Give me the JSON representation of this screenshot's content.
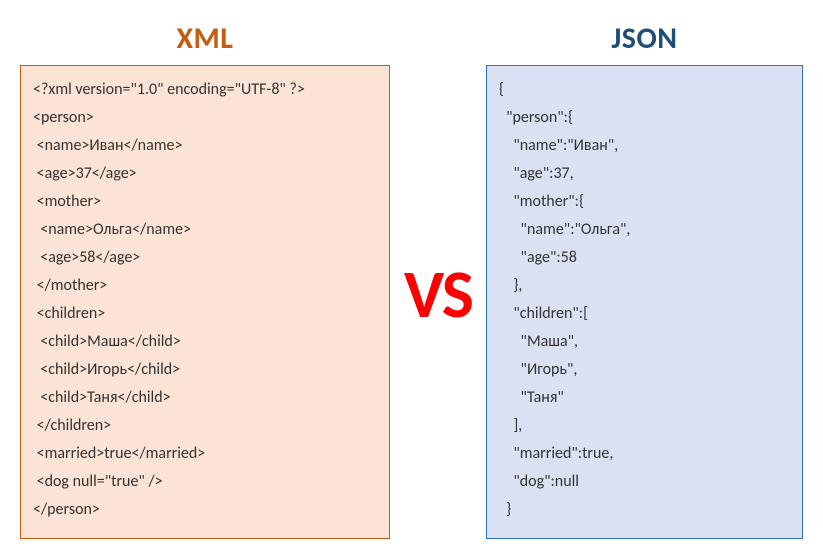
{
  "left": {
    "title": "XML",
    "lines": [
      "<?xml version=\"1.0\" encoding=\"UTF-8\" ?>",
      "<person>",
      " <name>Иван</name>",
      " <age>37</age>",
      " <mother>",
      "  <name>Ольга</name>",
      "  <age>58</age>",
      " </mother>",
      " <children>",
      "  <child>Маша</child>",
      "  <child>Игорь</child>",
      "  <child>Таня</child>",
      " </children>",
      " <married>true</married>",
      " <dog null=\"true\" />",
      "</person>"
    ]
  },
  "right": {
    "title": "JSON",
    "lines": [
      "{",
      "  \"person\":{",
      "    \"name\":\"Иван\",",
      "    \"age\":37,",
      "    \"mother\":{",
      "      \"name\":\"Ольга\",",
      "      \"age\":58",
      "    },",
      "    \"children\":[",
      "      \"Маша\",",
      "      \"Игорь\",",
      "      \"Таня\"",
      "    ],",
      "    \"married\":true,",
      "    \"dog\":null",
      "  }"
    ]
  },
  "vs": "VS"
}
